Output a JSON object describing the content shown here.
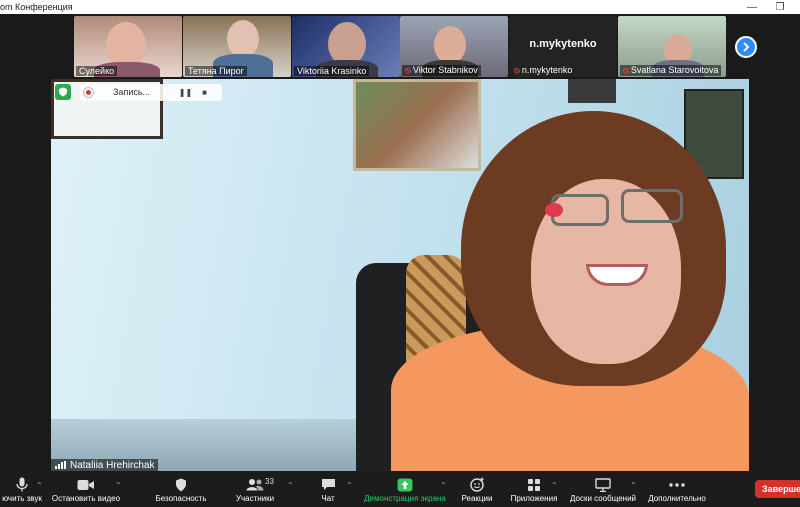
{
  "window": {
    "title": "om Конференция",
    "minimize_glyph": "—",
    "restore_glyph": "❐"
  },
  "gallery": {
    "participants": [
      {
        "name": "Сулейко",
        "muted": false
      },
      {
        "name": "Тетяна Пирог",
        "muted": false
      },
      {
        "name": "Viktoriia Krasinko",
        "muted": false
      },
      {
        "name": "Viktor Stabnikov",
        "muted": true
      },
      {
        "name": "n.mykytenko",
        "muted": true,
        "video_off": true,
        "display": "n.mykytenko"
      },
      {
        "name": "Svatlana Starovoitova",
        "muted": true
      }
    ],
    "next_icon": "chevron-right-icon"
  },
  "recording": {
    "label": "Запись...",
    "pause_glyph": "❚❚",
    "stop_glyph": "■"
  },
  "speaker": {
    "name": "Nataliia Hrehirchak"
  },
  "toolbar": {
    "items": [
      {
        "label": "ючить звук",
        "icon": "microphone-icon"
      },
      {
        "label": "Остановить видео",
        "icon": "video-camera-icon"
      },
      {
        "label": "Безопасность",
        "icon": "shield-icon"
      },
      {
        "label": "Участники",
        "icon": "participants-icon",
        "count": "33"
      },
      {
        "label": "Чат",
        "icon": "chat-icon"
      },
      {
        "label": "Демонстрация экрана",
        "icon": "share-screen-icon"
      },
      {
        "label": "Реакции",
        "icon": "reactions-icon"
      },
      {
        "label": "Приложения",
        "icon": "apps-icon"
      },
      {
        "label": "Доски сообщений",
        "icon": "whiteboard-icon"
      },
      {
        "label": "Дополнительно",
        "icon": "more-icon"
      }
    ],
    "end_label": "Завершен"
  },
  "colors": {
    "share_green": "#32c95e",
    "end_red": "#d6302c",
    "accent_blue": "#2d8cff"
  }
}
